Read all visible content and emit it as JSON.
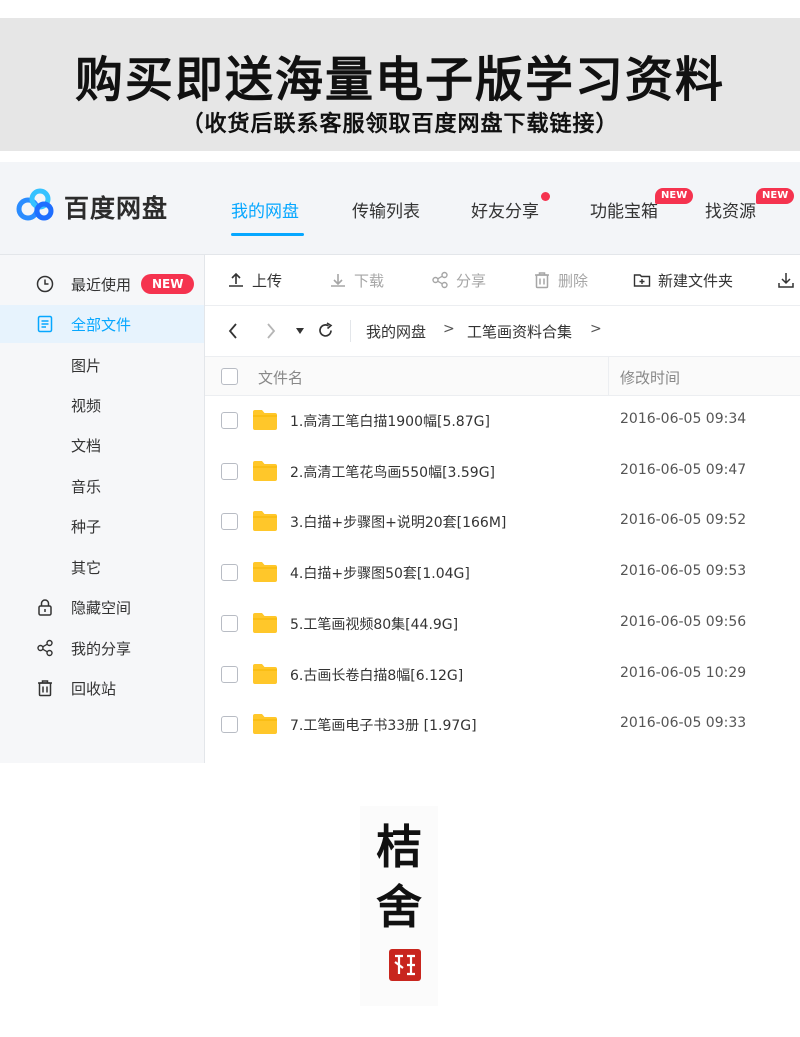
{
  "banner": {
    "title": "购买即送海量电子版学习资料",
    "subtitle": "（收货后联系客服领取百度网盘下载链接）"
  },
  "app": {
    "name": "百度网盘",
    "nav": [
      {
        "label": "我的网盘",
        "active": true
      },
      {
        "label": "传输列表"
      },
      {
        "label": "好友分享",
        "dot": true
      },
      {
        "label": "功能宝箱",
        "badge": "NEW"
      },
      {
        "label": "找资源",
        "badge": "NEW"
      }
    ]
  },
  "sidebar": {
    "recent": {
      "label": "最近使用",
      "badge": "NEW"
    },
    "all_files": "全部文件",
    "categories": [
      "图片",
      "视频",
      "文档",
      "音乐",
      "种子",
      "其它"
    ],
    "hidden_space": "隐藏空间",
    "my_share": "我的分享",
    "recycle_bin": "回收站"
  },
  "toolbar": {
    "upload": "上传",
    "download": "下载",
    "share": "分享",
    "delete": "删除",
    "new_folder": "新建文件夹"
  },
  "breadcrumb": {
    "root": "我的网盘",
    "current": "工笔画资料合集",
    "separator": ">"
  },
  "table": {
    "col_name": "文件名",
    "col_modified": "修改时间",
    "rows": [
      {
        "name": "1.高清工笔白描1900幅[5.87G]",
        "modified": "2016-06-05 09:34"
      },
      {
        "name": "2.高清工笔花鸟画550幅[3.59G]",
        "modified": "2016-06-05 09:47"
      },
      {
        "name": "3.白描+步骤图+说明20套[166M]",
        "modified": "2016-06-05 09:52"
      },
      {
        "name": "4.白描+步骤图50套[1.04G]",
        "modified": "2016-06-05 09:53"
      },
      {
        "name": "5.工笔画视频80集[44.9G]",
        "modified": "2016-06-05 09:56"
      },
      {
        "name": "6.古画长卷白描8幅[6.12G]",
        "modified": "2016-06-05 10:29"
      },
      {
        "name": "7.工笔画电子书33册 [1.97G]",
        "modified": "2016-06-05 09:33"
      }
    ]
  },
  "seal": {
    "characters": [
      "桔",
      "舍"
    ]
  },
  "colors": {
    "accent": "#06a7ff",
    "badge_red": "#f5334f",
    "folder_yellow": "#ffc72a",
    "banner_bg": "#e6e6e6"
  }
}
